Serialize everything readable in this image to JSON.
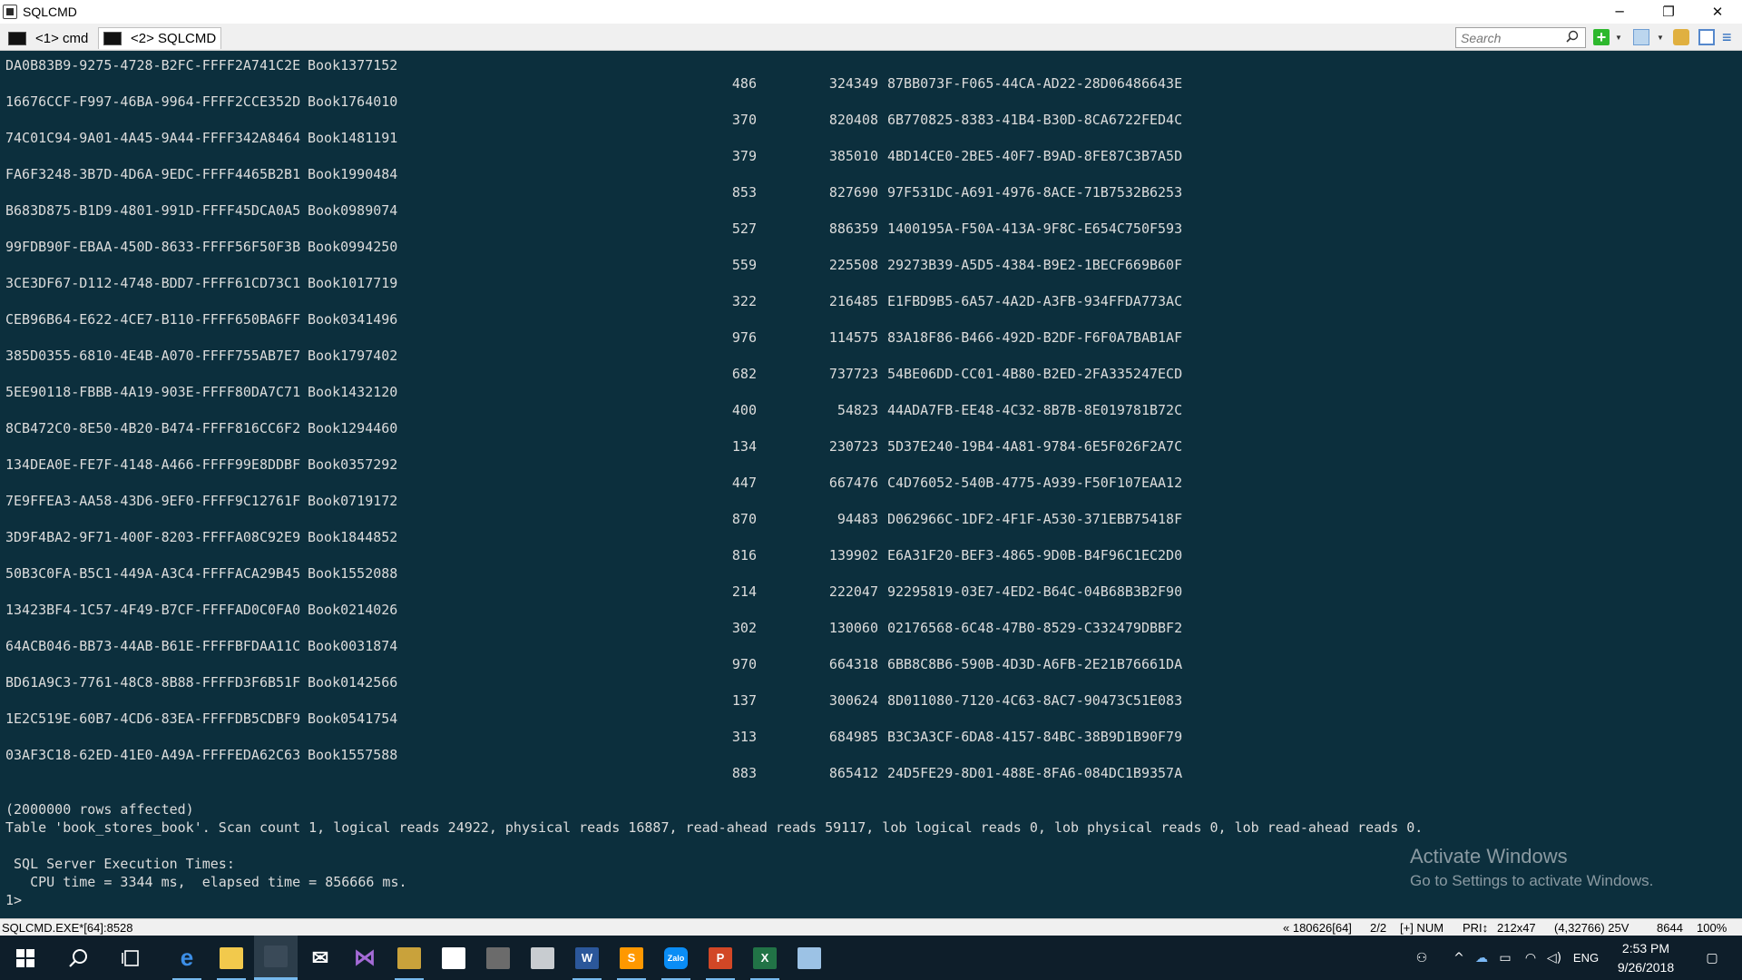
{
  "window": {
    "title": "SQLCMD",
    "controls": {
      "minimize": "─",
      "restore": "❐",
      "close": "✕"
    }
  },
  "tabs": [
    {
      "label": "<1> cmd"
    },
    {
      "label": "<2> SQLCMD",
      "active": true
    }
  ],
  "toolbar": {
    "search_placeholder": "Search"
  },
  "console": {
    "rows": [
      {
        "guid": "DA0B83B9-9275-4728-B2FC-FFFF2A741C2E",
        "book": "Book1377152",
        "num1": "486",
        "num2": "324349",
        "guid2": "87BB073F-F065-44CA-AD22-28D06486643E"
      },
      {
        "guid": "16676CCF-F997-46BA-9964-FFFF2CCE352D",
        "book": "Book1764010",
        "num1": "370",
        "num2": "820408",
        "guid2": "6B770825-8383-41B4-B30D-8CA6722FED4C"
      },
      {
        "guid": "74C01C94-9A01-4A45-9A44-FFFF342A8464",
        "book": "Book1481191",
        "num1": "379",
        "num2": "385010",
        "guid2": "4BD14CE0-2BE5-40F7-B9AD-8FE87C3B7A5D"
      },
      {
        "guid": "FA6F3248-3B7D-4D6A-9EDC-FFFF4465B2B1",
        "book": "Book1990484",
        "num1": "853",
        "num2": "827690",
        "guid2": "97F531DC-A691-4976-8ACE-71B7532B6253"
      },
      {
        "guid": "B683D875-B1D9-4801-991D-FFFF45DCA0A5",
        "book": "Book0989074",
        "num1": "527",
        "num2": "886359",
        "guid2": "1400195A-F50A-413A-9F8C-E654C750F593"
      },
      {
        "guid": "99FDB90F-EBAA-450D-8633-FFFF56F50F3B",
        "book": "Book0994250",
        "num1": "559",
        "num2": "225508",
        "guid2": "29273B39-A5D5-4384-B9E2-1BECF669B60F"
      },
      {
        "guid": "3CE3DF67-D112-4748-BDD7-FFFF61CD73C1",
        "book": "Book1017719",
        "num1": "322",
        "num2": "216485",
        "guid2": "E1FBD9B5-6A57-4A2D-A3FB-934FFDA773AC"
      },
      {
        "guid": "CEB96B64-E622-4CE7-B110-FFFF650BA6FF",
        "book": "Book0341496",
        "num1": "976",
        "num2": "114575",
        "guid2": "83A18F86-B466-492D-B2DF-F6F0A7BAB1AF"
      },
      {
        "guid": "385D0355-6810-4E4B-A070-FFFF755AB7E7",
        "book": "Book1797402",
        "num1": "682",
        "num2": "737723",
        "guid2": "54BE06DD-CC01-4B80-B2ED-2FA335247ECD"
      },
      {
        "guid": "5EE90118-FBBB-4A19-903E-FFFF80DA7C71",
        "book": "Book1432120",
        "num1": "400",
        "num2": "54823",
        "guid2": "44ADA7FB-EE48-4C32-8B7B-8E019781B72C"
      },
      {
        "guid": "8CB472C0-8E50-4B20-B474-FFFF816CC6F2",
        "book": "Book1294460",
        "num1": "134",
        "num2": "230723",
        "guid2": "5D37E240-19B4-4A81-9784-6E5F026F2A7C"
      },
      {
        "guid": "134DEA0E-FE7F-4148-A466-FFFF99E8DDBF",
        "book": "Book0357292",
        "num1": "447",
        "num2": "667476",
        "guid2": "C4D76052-540B-4775-A939-F50F107EAA12"
      },
      {
        "guid": "7E9FFEA3-AA58-43D6-9EF0-FFFF9C12761F",
        "book": "Book0719172",
        "num1": "870",
        "num2": "94483",
        "guid2": "D062966C-1DF2-4F1F-A530-371EBB75418F"
      },
      {
        "guid": "3D9F4BA2-9F71-400F-8203-FFFFA08C92E9",
        "book": "Book1844852",
        "num1": "816",
        "num2": "139902",
        "guid2": "E6A31F20-BEF3-4865-9D0B-B4F96C1EC2D0"
      },
      {
        "guid": "50B3C0FA-B5C1-449A-A3C4-FFFFACA29B45",
        "book": "Book1552088",
        "num1": "214",
        "num2": "222047",
        "guid2": "92295819-03E7-4ED2-B64C-04B68B3B2F90"
      },
      {
        "guid": "13423BF4-1C57-4F49-B7CF-FFFFAD0C0FA0",
        "book": "Book0214026",
        "num1": "302",
        "num2": "130060",
        "guid2": "02176568-6C48-47B0-8529-C332479DBBF2"
      },
      {
        "guid": "64ACB046-BB73-44AB-B61E-FFFFBFDAA11C",
        "book": "Book0031874",
        "num1": "970",
        "num2": "664318",
        "guid2": "6BB8C8B6-590B-4D3D-A6FB-2E21B76661DA"
      },
      {
        "guid": "BD61A9C3-7761-48C8-8B88-FFFFD3F6B51F",
        "book": "Book0142566",
        "num1": "137",
        "num2": "300624",
        "guid2": "8D011080-7120-4C63-8AC7-90473C51E083"
      },
      {
        "guid": "1E2C519E-60B7-4CD6-83EA-FFFFDB5CDBF9",
        "book": "Book0541754",
        "num1": "313",
        "num2": "684985",
        "guid2": "B3C3A3CF-6DA8-4157-84BC-38B9D1B90F79"
      },
      {
        "guid": "03AF3C18-62ED-41E0-A49A-FFFFEDA62C63",
        "book": "Book1557588",
        "num1": "883",
        "num2": "865412",
        "guid2": "24D5FE29-8D01-488E-8FA6-084DC1B9357A"
      }
    ],
    "rows_affected": "(2000000 rows affected)",
    "stats_line": "Table 'book_stores_book'. Scan count 1, logical reads 24922, physical reads 16887, read-ahead reads 59117, lob logical reads 0, lob physical reads 0, lob read-ahead reads 0.",
    "exec_times_header": " SQL Server Execution Times:",
    "cpu_time": "   CPU time = 3344 ms,  elapsed time = 856666 ms.",
    "prompt": "1>"
  },
  "watermark": {
    "title": "Activate Windows",
    "subtitle": "Go to Settings to activate Windows."
  },
  "statusbar": {
    "process": "SQLCMD.EXE*[64]:8528",
    "buffer": "« 180626[64]",
    "console_index": "2/2",
    "keys": "[+] NUM",
    "priority": "PRI↕",
    "size": "212x47",
    "cursor": "(4,32766) 25V",
    "pid": "8644",
    "zoom": "100%"
  },
  "taskbar": {
    "apps": [
      {
        "name": "Microsoft Edge",
        "icon": "edge-icon",
        "glyph": "e",
        "color": "#1e73d6"
      },
      {
        "name": "File Explorer",
        "icon": "folder-icon",
        "glyph": "",
        "color": "#f2c94c"
      },
      {
        "name": "ConEmu",
        "icon": "console-icon",
        "glyph": "",
        "color": "#3a4a58"
      },
      {
        "name": "Mail",
        "icon": "mail-icon",
        "glyph": "✉",
        "color": "#0e1e2a"
      },
      {
        "name": "Visual Studio",
        "icon": "visual-studio-icon",
        "glyph": "⋈",
        "color": "#68217a"
      },
      {
        "name": "Tools",
        "icon": "tools-icon",
        "glyph": "",
        "color": "#c9a23b"
      },
      {
        "name": "Notes",
        "icon": "notes-icon",
        "glyph": "",
        "color": "#ffffff"
      },
      {
        "name": "Terminal",
        "icon": "terminal-icon",
        "glyph": "",
        "color": "#6b6b6b"
      },
      {
        "name": "SQL Server",
        "icon": "sql-server-icon",
        "glyph": "",
        "color": "#c8ccd0"
      },
      {
        "name": "Word",
        "icon": "word-icon",
        "glyph": "W",
        "color": "#2b579a"
      },
      {
        "name": "Sublime Text",
        "icon": "sublime-icon",
        "glyph": "S",
        "color": "#ff9800"
      },
      {
        "name": "Zalo",
        "icon": "zalo-icon",
        "glyph": "Zalo",
        "color": "#0a8df5"
      },
      {
        "name": "PowerPoint",
        "icon": "powerpoint-icon",
        "glyph": "P",
        "color": "#d24726"
      },
      {
        "name": "Excel",
        "icon": "excel-icon",
        "glyph": "X",
        "color": "#217346"
      },
      {
        "name": "Paint",
        "icon": "paint-icon",
        "glyph": "",
        "color": "#9cc2e5"
      }
    ],
    "language": "ENG",
    "time": "2:53 PM",
    "date": "9/26/2018"
  }
}
